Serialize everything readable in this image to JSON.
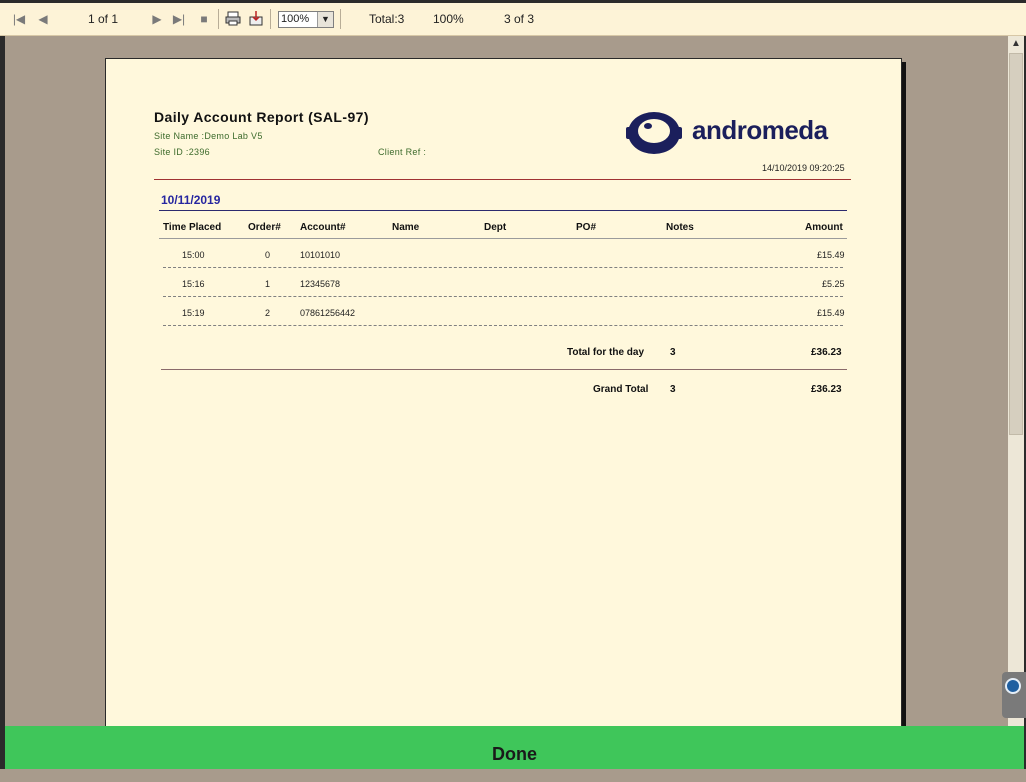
{
  "toolbar": {
    "first_page_icon": "first-page-icon",
    "prev_page_icon": "prev-page-icon",
    "page_of": "1 of 1",
    "next_page_icon": "next-page-icon",
    "last_page_icon": "last-page-icon",
    "stop_icon": "stop-icon",
    "print_icon": "printer-icon",
    "export_icon": "export-icon",
    "zoom_value": "100%",
    "total": "Total:3",
    "percent": "100%",
    "count": "3 of 3"
  },
  "report": {
    "title": "Daily Account Report (SAL-97)",
    "site_name": "Site Name :Demo Lab V5",
    "site_id": "Site ID :2396",
    "client_ref": "Client Ref :",
    "logo_text": "andromeda",
    "timestamp": "14/10/2019  09:20:25",
    "date": "10/11/2019",
    "columns": [
      "Time Placed",
      "Order#",
      "Account#",
      "Name",
      "Dept",
      "PO#",
      "Notes",
      "Amount"
    ],
    "rows": [
      {
        "time": "15:00",
        "order": "0",
        "account": "10101010",
        "amount": "£15.49"
      },
      {
        "time": "15:16",
        "order": "1",
        "account": "12345678",
        "amount": "£5.25"
      },
      {
        "time": "15:19",
        "order": "2",
        "account": "07861256442",
        "amount": "£15.49"
      }
    ],
    "day_total_label": "Total for the day",
    "day_total_count": "3",
    "day_total_amount": "£36.23",
    "grand_total_label": "Grand Total",
    "grand_total_count": "3",
    "grand_total_amount": "£36.23"
  },
  "done_button": "Done",
  "colors": {
    "done_green": "#3fc65a",
    "brand_navy": "#1b1f5c",
    "date_blue": "#2626a0",
    "meta_green": "#3d6b2c"
  }
}
